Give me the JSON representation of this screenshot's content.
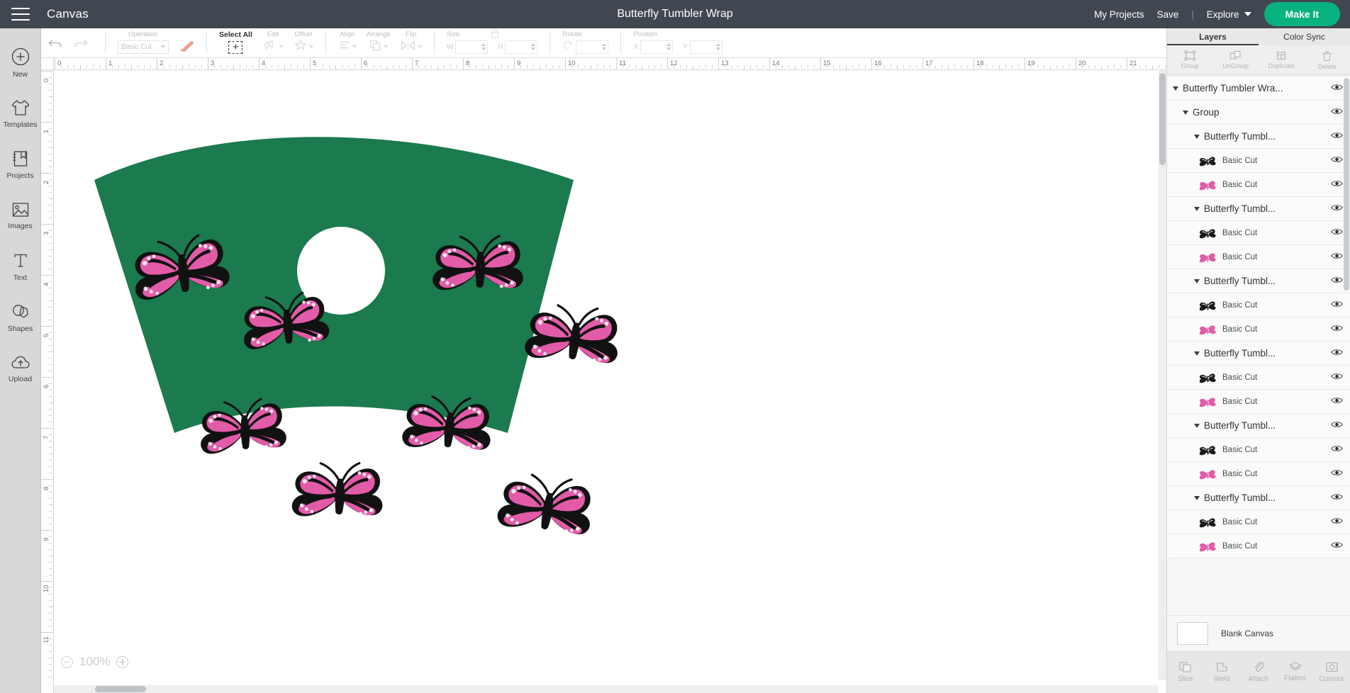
{
  "header": {
    "menu_icon": "hamburger-icon",
    "canvas_label": "Canvas",
    "project_title": "Butterfly Tumbler Wrap",
    "my_projects": "My Projects",
    "save": "Save",
    "separator": "|",
    "explore": "Explore",
    "make_it": "Make It",
    "accent_color": "#08b27f",
    "bar_color": "#414750"
  },
  "sidebar": {
    "items": [
      {
        "label": "New",
        "icon": "plus-circle-icon"
      },
      {
        "label": "Templates",
        "icon": "tshirt-icon"
      },
      {
        "label": "Projects",
        "icon": "book-bookmark-icon"
      },
      {
        "label": "Images",
        "icon": "picture-icon"
      },
      {
        "label": "Text",
        "icon": "text-icon"
      },
      {
        "label": "Shapes",
        "icon": "shapes-icon"
      },
      {
        "label": "Upload",
        "icon": "cloud-upload-icon"
      }
    ]
  },
  "toolbar": {
    "undo": "undo-icon",
    "redo": "redo-icon",
    "operation_caption": "Operation",
    "operation_value": "Basic Cut",
    "select_all": "Select All",
    "edit": "Edit",
    "offset": "Offset",
    "align": "Align",
    "arrange": "Arrange",
    "flip": "Flip",
    "size_caption": "Size",
    "size_w_label": "W",
    "size_w_value": "",
    "size_h_label": "H",
    "size_h_value": "",
    "lock_icon": "lock-icon",
    "rotate_caption": "Rotate",
    "rotate_value": "",
    "position_caption": "Position",
    "position_x_label": "X",
    "position_x_value": "",
    "position_y_label": "Y",
    "position_y_value": ""
  },
  "canvas": {
    "zoom_level": "100%",
    "zoom_out": "minus-circle-icon",
    "zoom_in": "plus-circle-icon",
    "ruler_h_ticks": [
      "0",
      "1",
      "2",
      "3",
      "4",
      "5",
      "6",
      "7",
      "8",
      "9",
      "10",
      "11",
      "12",
      "13",
      "14",
      "15",
      "16",
      "17",
      "18",
      "19",
      "20",
      "21"
    ],
    "ruler_v_ticks": [
      "0",
      "1",
      "2",
      "3",
      "4",
      "5",
      "6",
      "7",
      "8",
      "9",
      "10",
      "11"
    ],
    "shape_color": "#1b7a4e",
    "butterfly_pink": "#e25ba8",
    "butterfly_outline": "#111111",
    "butterfly_count": 8
  },
  "right_panel": {
    "tabs": [
      {
        "label": "Layers",
        "active": true
      },
      {
        "label": "Color Sync",
        "active": false
      }
    ],
    "actions": [
      {
        "label": "Group",
        "icon": "group-icon"
      },
      {
        "label": "UnGroup",
        "icon": "ungroup-icon"
      },
      {
        "label": "Duplicate",
        "icon": "duplicate-icon"
      },
      {
        "label": "Delete",
        "icon": "trash-icon"
      }
    ],
    "layers": [
      {
        "name": "Butterfly Tumbler Wra...",
        "indent": 0,
        "kind": "group",
        "eye": "eye-icon"
      },
      {
        "name": "Group",
        "indent": 1,
        "kind": "group",
        "eye": "eye-icon"
      },
      {
        "name": "Butterfly Tumbl...",
        "indent": 2,
        "kind": "group",
        "eye": "eye-icon"
      },
      {
        "name": "Basic Cut",
        "indent": 3,
        "kind": "layer",
        "swatch": "black",
        "eye": "eye-icon"
      },
      {
        "name": "Basic Cut",
        "indent": 3,
        "kind": "layer",
        "swatch": "pink",
        "eye": "eye-icon"
      },
      {
        "name": "Butterfly Tumbl...",
        "indent": 2,
        "kind": "group",
        "eye": "eye-icon"
      },
      {
        "name": "Basic Cut",
        "indent": 3,
        "kind": "layer",
        "swatch": "black",
        "eye": "eye-icon"
      },
      {
        "name": "Basic Cut",
        "indent": 3,
        "kind": "layer",
        "swatch": "pink",
        "eye": "eye-icon"
      },
      {
        "name": "Butterfly Tumbl...",
        "indent": 2,
        "kind": "group",
        "eye": "eye-icon"
      },
      {
        "name": "Basic Cut",
        "indent": 3,
        "kind": "layer",
        "swatch": "black",
        "eye": "eye-icon"
      },
      {
        "name": "Basic Cut",
        "indent": 3,
        "kind": "layer",
        "swatch": "pink",
        "eye": "eye-icon"
      },
      {
        "name": "Butterfly Tumbl...",
        "indent": 2,
        "kind": "group",
        "eye": "eye-icon"
      },
      {
        "name": "Basic Cut",
        "indent": 3,
        "kind": "layer",
        "swatch": "black",
        "eye": "eye-icon"
      },
      {
        "name": "Basic Cut",
        "indent": 3,
        "kind": "layer",
        "swatch": "pink",
        "eye": "eye-icon"
      },
      {
        "name": "Butterfly Tumbl...",
        "indent": 2,
        "kind": "group",
        "eye": "eye-icon"
      },
      {
        "name": "Basic Cut",
        "indent": 3,
        "kind": "layer",
        "swatch": "black",
        "eye": "eye-icon"
      },
      {
        "name": "Basic Cut",
        "indent": 3,
        "kind": "layer",
        "swatch": "pink",
        "eye": "eye-icon"
      },
      {
        "name": "Butterfly Tumbl...",
        "indent": 2,
        "kind": "group",
        "eye": "eye-icon"
      },
      {
        "name": "Basic Cut",
        "indent": 3,
        "kind": "layer",
        "swatch": "black",
        "eye": "eye-icon"
      },
      {
        "name": "Basic Cut",
        "indent": 3,
        "kind": "layer",
        "swatch": "pink",
        "eye": "eye-icon"
      }
    ],
    "blank_canvas": "Blank Canvas",
    "bottom_tools": [
      {
        "label": "Slice",
        "icon": "slice-icon"
      },
      {
        "label": "Weld",
        "icon": "weld-icon"
      },
      {
        "label": "Attach",
        "icon": "paperclip-icon"
      },
      {
        "label": "Flatten",
        "icon": "flatten-icon"
      },
      {
        "label": "Contour",
        "icon": "contour-icon"
      }
    ]
  }
}
